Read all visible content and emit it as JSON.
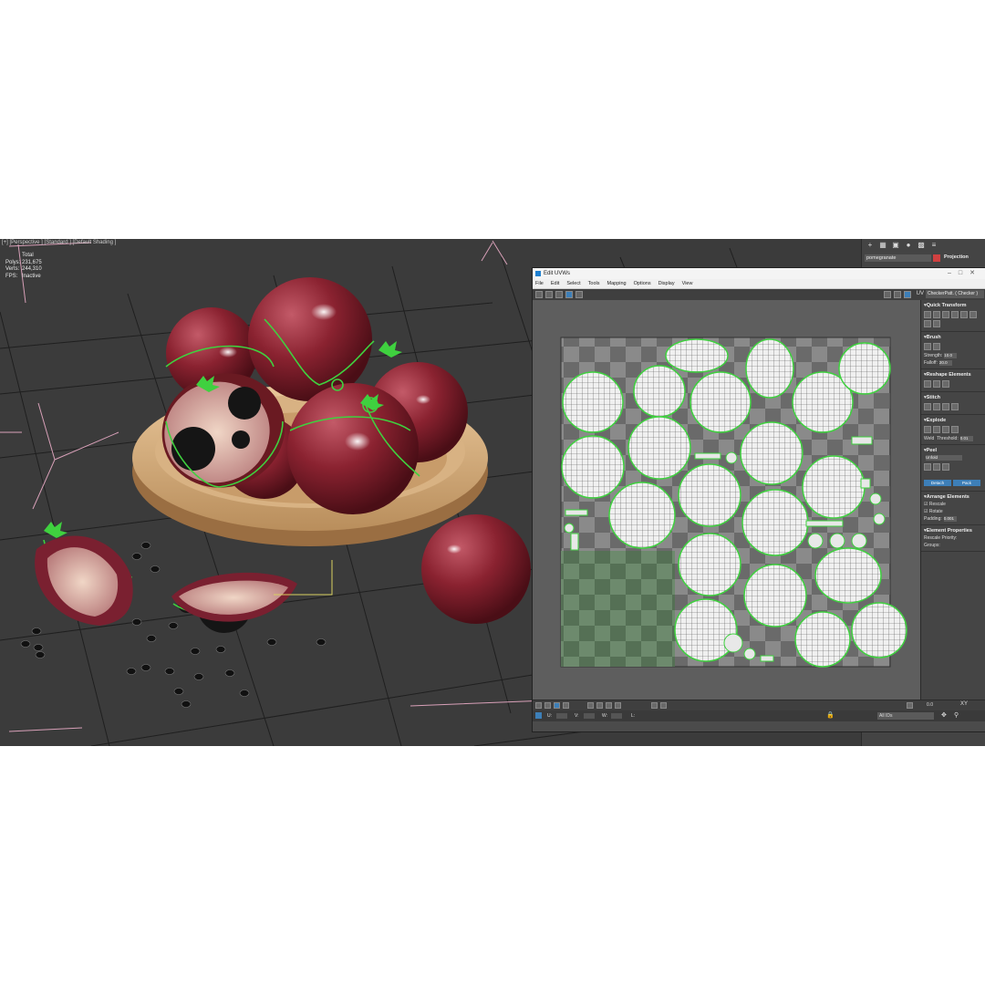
{
  "viewport": {
    "label": "[+] [Perspective ] [Standard ] [Default Shading ]",
    "stats": [
      {
        "key": "",
        "value": "Total"
      },
      {
        "key": "Polys:",
        "value": "231,675"
      },
      {
        "key": "Verts:",
        "value": "244,310"
      },
      {
        "key": "",
        "value": ""
      },
      {
        "key": "FPS:",
        "value": "Inactive"
      }
    ]
  },
  "command_panel": {
    "object_name": "pomegranate",
    "object_color": "#d04040",
    "rollout": "Projection"
  },
  "uv_editor": {
    "title": "Edit UVWs",
    "menu": [
      "File",
      "Edit",
      "Select",
      "Tools",
      "Mapping",
      "Options",
      "Display",
      "View"
    ],
    "uv_label": "UV",
    "checker_map": "CheckerPatt. ( Checker )",
    "side": {
      "quick_transform": "Quick Transform",
      "brush": "Brush",
      "strength_label": "Strength:",
      "strength_value": "10.0",
      "falloff_label": "Falloff:",
      "falloff_value": "20.0",
      "reshape": "Reshape Elements",
      "stitch": "Stitch",
      "explode": "Explode",
      "weld_label": "Weld",
      "threshold_label": "Threshold:",
      "threshold_value": "0.01",
      "peel": "Peel",
      "unfold_label": "Unfold",
      "detach_label": "Detach",
      "pack_label": "Pack",
      "arrange": "Arrange Elements",
      "rescale_label": "Rescale",
      "rotate_label": "Rotate",
      "padding_label": "Padding:",
      "padding_value": "0.001",
      "element_props": "Element Properties",
      "rescale_priority_label": "Rescale Priority:",
      "groups_label": "Groups:"
    },
    "status": {
      "u_label": "U:",
      "v_label": "V:",
      "w_label": "W:",
      "l_label": "L:",
      "ids_label": "All IDs",
      "zoom_value": "0.0",
      "axis_label": "XY"
    },
    "accent_color": "#3d7fb8",
    "seam_color": "#3fd13f"
  }
}
